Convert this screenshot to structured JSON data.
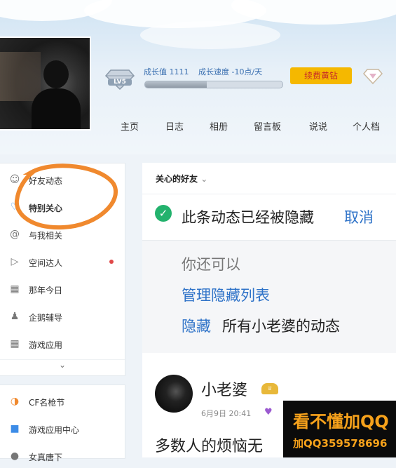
{
  "header": {
    "level": "LV5",
    "growth_value": "成长值 1111",
    "growth_speed": "成长速度 -10点/天",
    "growth_progress": 0.45,
    "renew_label": "续费黄钻"
  },
  "nav": [
    "主页",
    "日志",
    "相册",
    "留言板",
    "说说",
    "个人档"
  ],
  "sidebar": {
    "items": [
      {
        "label": "好友动态",
        "icon": "user-icon"
      },
      {
        "label": "特别关心",
        "icon": "heart-icon"
      },
      {
        "label": "与我相关",
        "icon": "at-icon"
      },
      {
        "label": "空间达人",
        "icon": "play-icon"
      },
      {
        "label": "那年今日",
        "icon": "calendar-icon"
      },
      {
        "label": "企鹅辅导",
        "icon": "penguin-icon"
      },
      {
        "label": "游戏应用",
        "icon": "grid-icon"
      }
    ],
    "more_items": [
      {
        "label": "CF名枪节",
        "icon": "cf-icon"
      },
      {
        "label": "游戏应用中心",
        "icon": "game-center-icon"
      },
      {
        "label": "女真唐下",
        "icon": "app-icon"
      }
    ]
  },
  "main": {
    "filter_label": "关心的好友",
    "hidden_message": "此条动态已经被隐藏",
    "cancel": "取消",
    "can_also": "你还可以",
    "manage_hidden": "管理隐藏列表",
    "hide": "隐藏",
    "hide_rest": "所有小老婆的动态",
    "post": {
      "author": "小老婆",
      "time": "6月9日 20:41",
      "text": "多数人的烦恼无"
    }
  },
  "watermark": {
    "line1": "看不懂加QQ",
    "line2": "加QQ359578696"
  },
  "colors": {
    "accent": "#2f73c8",
    "renew_bg": "#f5b800",
    "watermark": "#f7a21b",
    "annotation": "#f0892e"
  }
}
